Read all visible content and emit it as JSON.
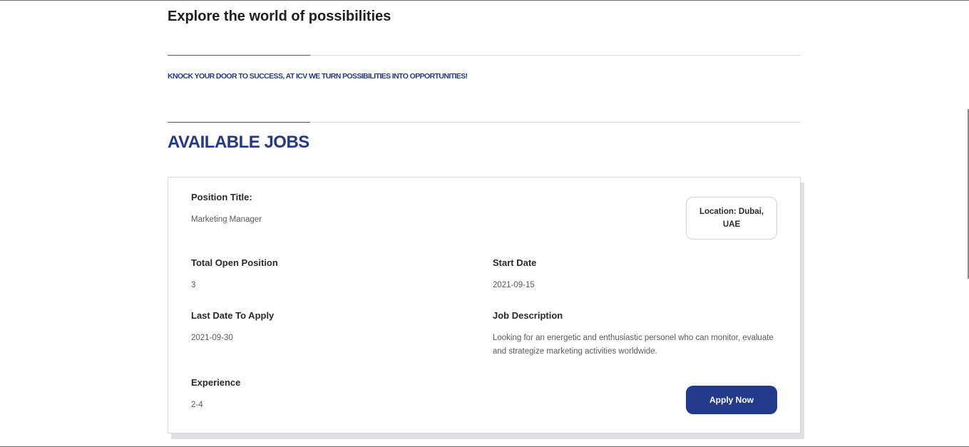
{
  "page": {
    "explore_title": "Explore the world of possibilities",
    "tagline": "KNOCK YOUR DOOR TO SUCCESS, AT ICV WE TURN POSSIBILITIES INTO OPPORTUNITIES!",
    "jobs_heading": "AVAILABLE JOBS"
  },
  "colors": {
    "brand_blue": "#22398c",
    "accent_red": "#d62828",
    "divider_gray": "#dcdcdc",
    "card_shadow": "#e0e0e4"
  },
  "job": {
    "position_title_label": "Position Title:",
    "position_title_value": "Marketing Manager",
    "location_badge": "Location: Dubai, UAE",
    "total_open_label": "Total Open Position",
    "total_open_value": "3",
    "start_date_label": "Start Date",
    "start_date_value": "2021-09-15",
    "last_date_label": "Last Date To Apply",
    "last_date_value": "2021-09-30",
    "description_label": "Job Description",
    "description_value": "Looking for an energetic and enthusiastic personel who can monitor, evaluate and strategize marketing activities worldwide.",
    "experience_label": "Experience",
    "experience_value": "2-4",
    "apply_label": "Apply Now"
  }
}
